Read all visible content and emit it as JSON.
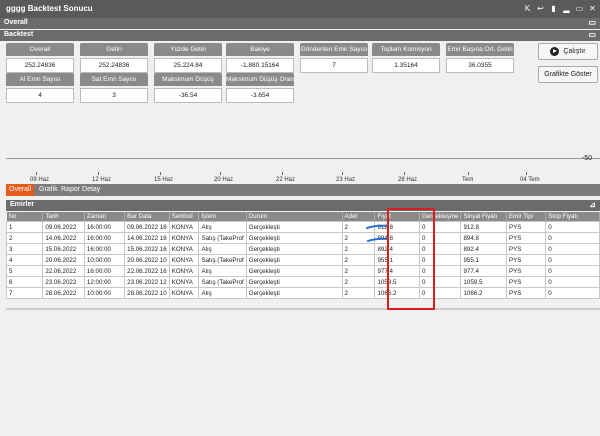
{
  "window": {
    "title": "gggg Backtest Sonucu",
    "ctrl_icons": [
      "K",
      "↩",
      "▮",
      "▂",
      "▭",
      "✕"
    ]
  },
  "overall_header": "Overall",
  "backtest_header": "Backtest",
  "cards": [
    {
      "label": "Overall",
      "value": "252.24836"
    },
    {
      "label": "Getiri",
      "value": "252.24836"
    },
    {
      "label": "Yüzde Getiri",
      "value": "25.224.84"
    },
    {
      "label": "Bakiye",
      "value": "-1.880.15164"
    },
    {
      "label": "Gönderilen Emir Sayısı",
      "value": "7"
    },
    {
      "label": "Toplam Komisyon",
      "value": "1.35164"
    },
    {
      "label": "Emir Başına Ort. Getiri",
      "value": "36.0355"
    },
    {
      "label": "Al Emri Sayısı",
      "value": "4"
    },
    {
      "label": "Sat Emri Sayısı",
      "value": "3"
    },
    {
      "label": "Maksimum Düşüş",
      "value": "-36.54"
    },
    {
      "label": "Maksimum Düşüş Oranı",
      "value": "-3.654"
    }
  ],
  "buttons": {
    "run": "Çalıştır",
    "graph": "Grafikte Göster"
  },
  "axis": {
    "scale": "-50",
    "ticks": [
      "09 Haz",
      "12 Haz",
      "15 Haz",
      "20 Haz",
      "22 Haz",
      "23 Haz",
      "28 Haz",
      "Tem",
      "04 Tem"
    ]
  },
  "tabs": [
    "Overall",
    "Grafik",
    "Rapor Detay"
  ],
  "orders": {
    "header": "Emirler",
    "columns": [
      "No",
      "Tarih",
      "Zaman",
      "Bar Data",
      "Sembol",
      "İşlem",
      "Durum",
      "Adet",
      "Fiyat",
      "Gerçekleşme",
      "Sinyal Fiyatı",
      "Emir Tipi",
      "Stop Fiyatı"
    ],
    "rows": [
      [
        "1",
        "09.06.2022",
        "16:00:00",
        "09.06.2022 16",
        "KONYA",
        "Alış",
        "Gerçekleşti",
        "2",
        "912.8",
        "0",
        "912.8",
        "PYS",
        "0"
      ],
      [
        "2",
        "14.06.2022",
        "16:00:00",
        "14.06.2022 16",
        "KONYA",
        "Satış (TakeProf",
        "Gerçekleşti",
        "2",
        "894.8",
        "0",
        "894.8",
        "PYS",
        "0"
      ],
      [
        "3",
        "15.06.2022",
        "16:00:00",
        "15.06.2022 16",
        "KONYA",
        "Alış",
        "Gerçekleşti",
        "2",
        "892.4",
        "0",
        "892.4",
        "PYS",
        "0"
      ],
      [
        "4",
        "20.06.2022",
        "10:00:00",
        "20.06.2022 10",
        "KONYA",
        "Satış (TakeProf",
        "Gerçekleşti",
        "2",
        "955.1",
        "0",
        "955.1",
        "PYS",
        "0"
      ],
      [
        "5",
        "22.06.2022",
        "16:00:00",
        "22.06.2022 16",
        "KONYA",
        "Alış",
        "Gerçekleşti",
        "2",
        "977.4",
        "0",
        "977.4",
        "PYS",
        "0"
      ],
      [
        "6",
        "23.06.2022",
        "12:00:00",
        "23.06.2022 12",
        "KONYA",
        "Satış (TakeProf",
        "Gerçekleşti",
        "2",
        "1059.5",
        "0",
        "1059.5",
        "PYS",
        "0"
      ],
      [
        "7",
        "28.06.2022",
        "10:00:00",
        "28.06.2022 10",
        "KONYA",
        "Alış",
        "Gerçekleşti",
        "2",
        "1066.2",
        "0",
        "1066.2",
        "PYS",
        "0"
      ]
    ]
  }
}
